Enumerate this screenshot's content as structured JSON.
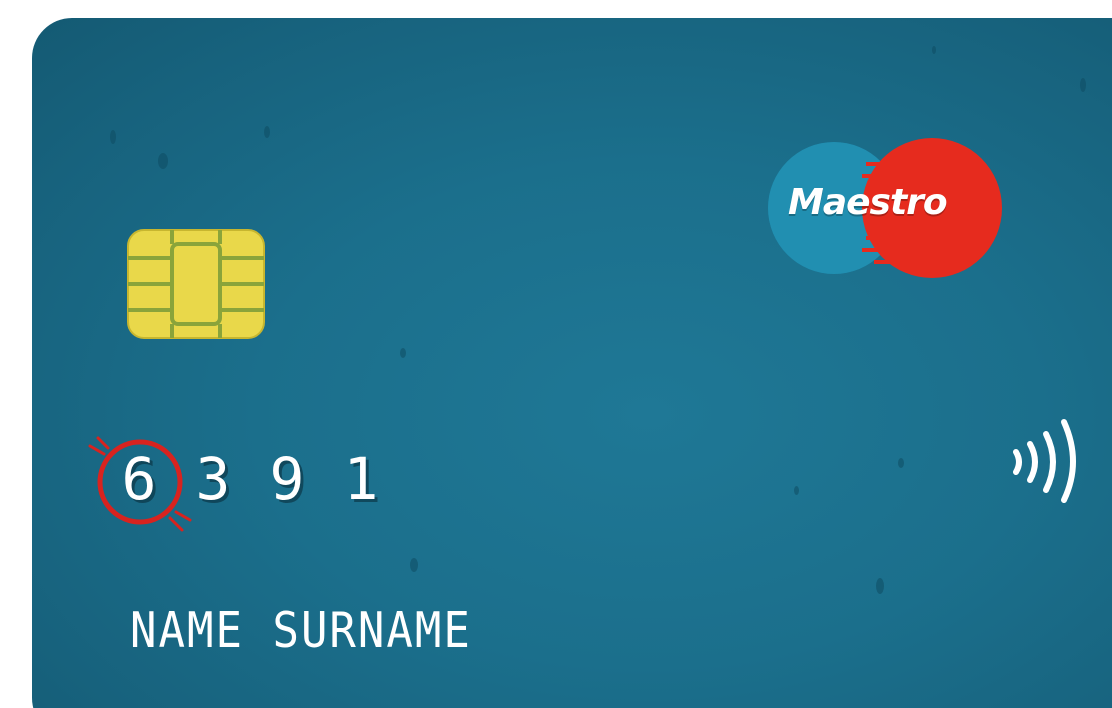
{
  "card": {
    "brand": "Maestro",
    "number_digits": [
      "6",
      "3",
      "9",
      "1"
    ],
    "holder_name": "NAME SURNAME",
    "highlighted_digit": "6"
  },
  "icons": {
    "chip": "emv-chip-icon",
    "contactless": "contactless-icon",
    "brand_logo": "maestro-logo",
    "annotation": "red-circle-annotation"
  },
  "colors": {
    "card_background": "#1b6f8c",
    "chip_gold": "#e9d84a",
    "chip_line": "#8aa43a",
    "maestro_blue": "#1f86a8",
    "maestro_red": "#e62b1e",
    "annotation_red": "#d8231f",
    "text_white": "#ffffff"
  }
}
